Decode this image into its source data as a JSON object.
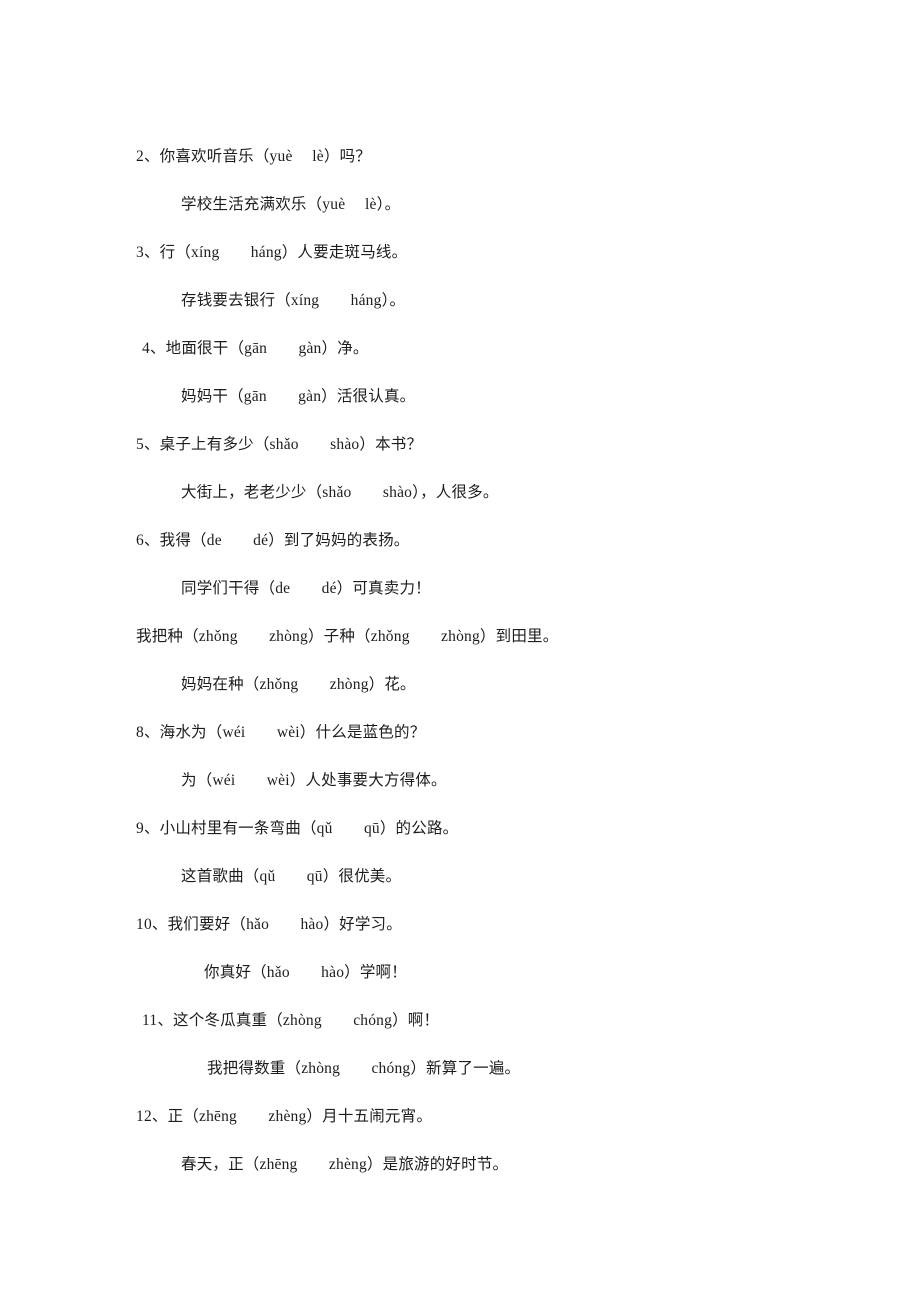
{
  "document": {
    "type": "worksheet",
    "language": "zh-CN",
    "page_background": "#ffffff",
    "text_color": "#1d1d1d",
    "lines": [
      {
        "id": "item-2-question",
        "indent": "main",
        "text": "2、你喜欢听音乐（yuè　 lè）吗？"
      },
      {
        "id": "item-2-example",
        "indent": "sub",
        "text": "学校生活充满欢乐（yuè　 lè）。"
      },
      {
        "id": "item-3-question",
        "indent": "main",
        "text": "3、行（xíng　　háng）人要走斑马线。"
      },
      {
        "id": "item-3-example",
        "indent": "sub",
        "text": "存钱要去银行（xíng　　háng）。"
      },
      {
        "id": "item-4-question",
        "indent": "main-indent",
        "text": "4、地面很干（gān　　gàn）净。"
      },
      {
        "id": "item-4-example",
        "indent": "sub",
        "text": "妈妈干（gān　　gàn）活很认真。"
      },
      {
        "id": "item-5-question",
        "indent": "main",
        "text": "5、桌子上有多少（shǎo　　shào）本书？"
      },
      {
        "id": "item-5-example",
        "indent": "sub",
        "text": "大街上，老老少少（shǎo　　shào），人很多。"
      },
      {
        "id": "item-6-question",
        "indent": "main",
        "text": "6、我得（de　　dé）到了妈妈的表扬。"
      },
      {
        "id": "item-6-example",
        "indent": "sub",
        "text": "同学们干得（de　　dé）可真卖力！"
      },
      {
        "id": "item-7-question",
        "indent": "main",
        "text": "我把种（zhǒng　　zhòng）子种（zhǒng　　zhòng）到田里。"
      },
      {
        "id": "item-7-example",
        "indent": "sub",
        "text": "妈妈在种（zhǒng　　zhòng）花。"
      },
      {
        "id": "item-8-question",
        "indent": "main",
        "text": "8、海水为（wéi　　wèi）什么是蓝色的？"
      },
      {
        "id": "item-8-example",
        "indent": "sub",
        "text": "为（wéi　　wèi）人处事要大方得体。"
      },
      {
        "id": "item-9-question",
        "indent": "main",
        "text": "9、小山村里有一条弯曲（qǔ　　qū）的公路。"
      },
      {
        "id": "item-9-example",
        "indent": "sub",
        "text": "这首歌曲（qǔ　　qū）很优美。"
      },
      {
        "id": "item-10-question",
        "indent": "main",
        "text": "10、我们要好（hǎo　　hào）好学习。"
      },
      {
        "id": "item-10-example",
        "indent": "sub-deep",
        "text": "你真好（hǎo　　hào）学啊！"
      },
      {
        "id": "item-11-question",
        "indent": "main-indent",
        "text": "11、这个冬瓜真重（zhòng　　chóng）啊！"
      },
      {
        "id": "item-11-example",
        "indent": "sub-deeper",
        "text": "我把得数重（zhòng　　chóng）新算了一遍。"
      },
      {
        "id": "item-12-question",
        "indent": "main",
        "text": "12、正（zhēng　　zhèng）月十五闹元宵。"
      },
      {
        "id": "item-12-example",
        "indent": "sub",
        "text": "春天，正（zhēng　　zhèng）是旅游的好时节。"
      }
    ]
  }
}
